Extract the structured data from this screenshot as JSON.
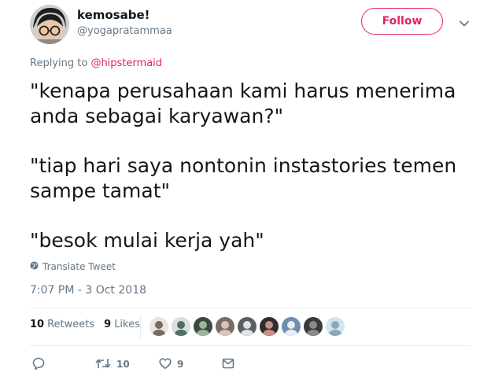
{
  "author": {
    "display_name": "kemosabe!",
    "username": "@yogapratammaa"
  },
  "follow_label": "Follow",
  "reply": {
    "prefix": "Replying to ",
    "mention": "@hipstermaid"
  },
  "tweet": {
    "paragraphs": [
      "\"kenapa perusahaan kami harus menerima anda sebagai karyawan?\"",
      "\"tiap hari saya nontonin instastories temen sampe tamat\"",
      "\"besok mulai kerja yah\""
    ]
  },
  "translate_label": "Translate Tweet",
  "timestamp": "7:07 PM - 3 Oct 2018",
  "stats": {
    "retweets_count": "10",
    "retweets_label": "Retweets",
    "likes_count": "9",
    "likes_label": "Likes"
  },
  "actions": {
    "reply_count": "",
    "retweet_count": "10",
    "like_count": "9"
  },
  "colors": {
    "accent": "#e0245e",
    "muted": "#657786",
    "text": "#14171a",
    "divider": "#e6ecf0"
  },
  "liker_avatars": [
    {
      "bg": "#e8e4e0",
      "fg": "#7a6a60"
    },
    {
      "bg": "#d6e0dc",
      "fg": "#4f6f66"
    },
    {
      "bg": "#3a4a3e",
      "fg": "#9fb59a"
    },
    {
      "bg": "#7a6b66",
      "fg": "#d9c3b8"
    },
    {
      "bg": "#5b5f63",
      "fg": "#dfe3e7"
    },
    {
      "bg": "#2e2e2e",
      "fg": "#c88f86"
    },
    {
      "bg": "#6f8fb0",
      "fg": "#e8eef5"
    },
    {
      "bg": "#3b3b3b",
      "fg": "#8a8a8a"
    },
    {
      "bg": "#d3e6ef",
      "fg": "#8aa9b8"
    }
  ]
}
